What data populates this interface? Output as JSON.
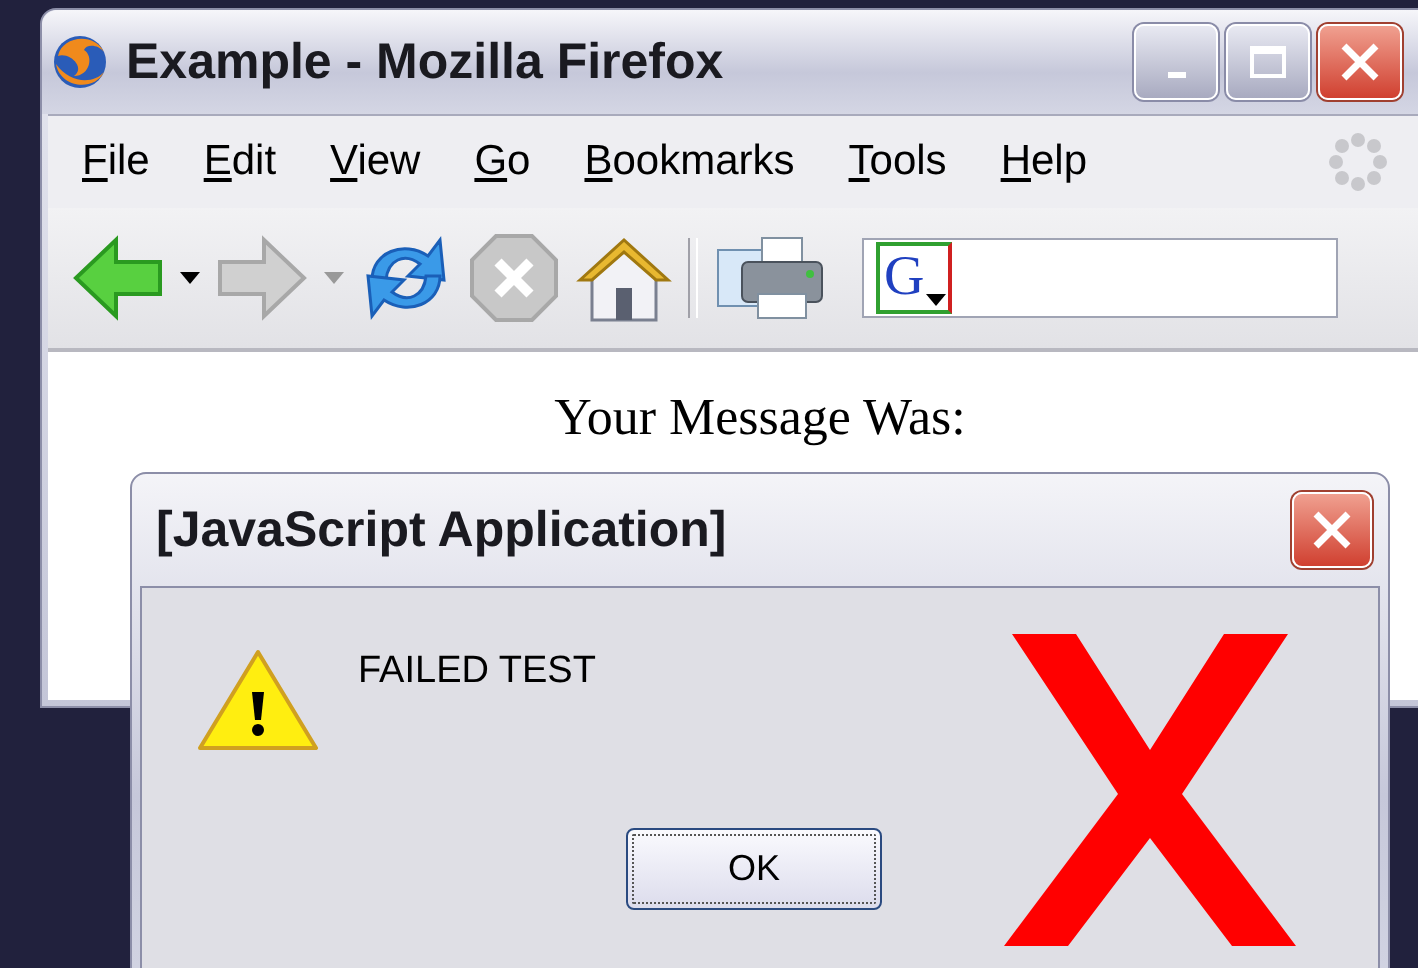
{
  "browser_window": {
    "title": "Example - Mozilla Firefox",
    "menu": [
      "File",
      "Edit",
      "View",
      "Go",
      "Bookmarks",
      "Tools",
      "Help"
    ],
    "search_engine_logo": "G",
    "page_heading": "Your Message Was:"
  },
  "dialog": {
    "title": "[JavaScript Application]",
    "message": "FAILED TEST",
    "button": "OK"
  }
}
